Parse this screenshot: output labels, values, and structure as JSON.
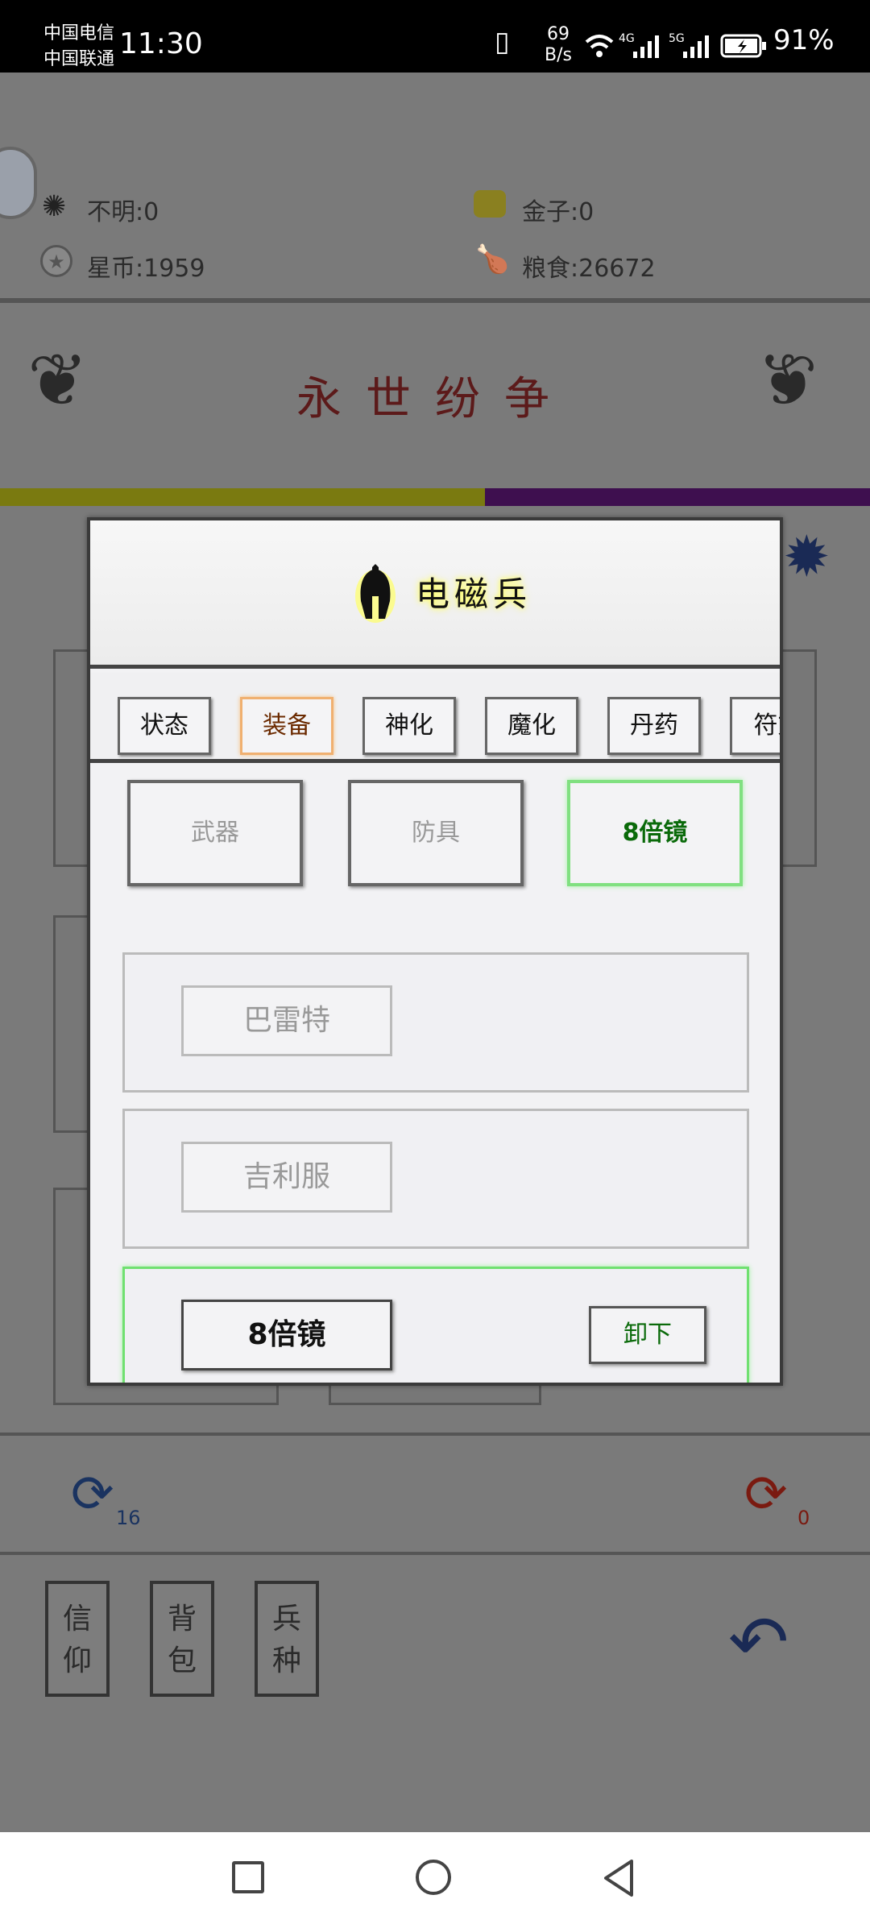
{
  "status_bar": {
    "carrier1": "中国电信",
    "carrier2": "中国联通",
    "time": "11:30",
    "net_speed_value": "69",
    "net_speed_unit": "B/s",
    "net4g": "4G",
    "net5g": "5G",
    "battery": "91%"
  },
  "resources": {
    "unknown": "不明:0",
    "gold": "金子:0",
    "starcoin": "星币:1959",
    "food": "粮食:26672"
  },
  "header": {
    "title": "永世纷争"
  },
  "refresh": {
    "left_count": "16",
    "right_count": "0"
  },
  "bottom_buttons": [
    {
      "label_top": "信",
      "label_bottom": "仰"
    },
    {
      "label_top": "背",
      "label_bottom": "包"
    },
    {
      "label_top": "兵",
      "label_bottom": "种"
    }
  ],
  "modal": {
    "title": "电磁兵",
    "tabs": [
      "状态",
      "装备",
      "神化",
      "魔化",
      "丹药",
      "符文"
    ],
    "active_tab": "装备",
    "slots": [
      "武器",
      "防具",
      "8倍镜"
    ],
    "items": [
      {
        "name": "巴雷特"
      },
      {
        "name": "吉利服"
      },
      {
        "name": "8倍镜",
        "action": "卸下"
      }
    ]
  },
  "colors": {
    "accent_green": "#0a6a0a",
    "active_tab_border": "#f0b070",
    "title_glow": "#ffff66"
  }
}
